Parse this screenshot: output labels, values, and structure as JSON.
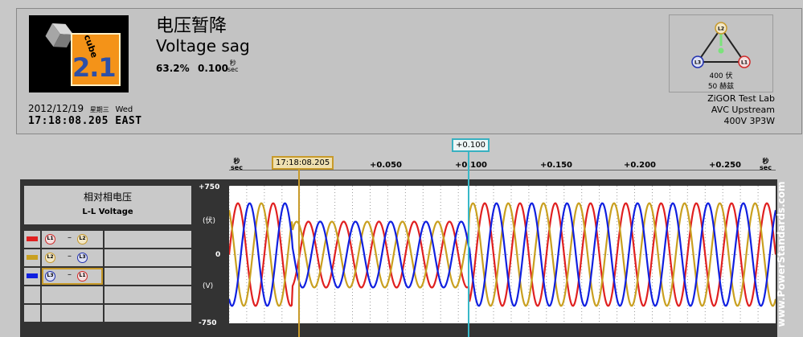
{
  "logo": {
    "word": "cube",
    "version": "2.1"
  },
  "event": {
    "date": "2012/12/19",
    "day_cn": "星期三",
    "day_en": "Wed",
    "time": "17:18:08.205",
    "tz": "EAST",
    "title_cn": "电压暂降",
    "title_en": "Voltage sag",
    "depth": "63.2%",
    "duration": "0.100",
    "duration_unit_cn": "秒",
    "duration_unit_en": "sec"
  },
  "phasor": {
    "labels": [
      "L1",
      "L2",
      "L3"
    ],
    "nominal_cn": "400 伏",
    "freq_cn": "50 赫兹"
  },
  "site": {
    "lab": "ZiGOR Test Lab",
    "location": "AVC Upstream",
    "config": "400V 3P3W"
  },
  "timeline": {
    "sec_cn": "秒",
    "sec_en": "sec",
    "ticks": [
      "+0.050",
      "+0.100",
      "+0.150",
      "+0.200",
      "+0.250"
    ],
    "trigger_label": "17:18:08.205",
    "cursor_label": "+0.100"
  },
  "legend": {
    "title_cn": "相对相电压",
    "title_en": "L-L Voltage",
    "rows": [
      {
        "a": "L1",
        "b": "L2",
        "color": "#e02020",
        "selected": false
      },
      {
        "a": "L2",
        "b": "L3",
        "color": "#c9a020",
        "selected": false
      },
      {
        "a": "L3",
        "b": "L1",
        "color": "#1020e0",
        "selected": true
      }
    ],
    "dash": "–"
  },
  "yaxis": {
    "top": "+750",
    "mid": "0",
    "bottom": "-750",
    "unit_top": "(伏)",
    "unit_bottom": "(V)"
  },
  "watermark": "www.PowerStandards.com",
  "chart_data": {
    "type": "line",
    "xlabel": "sec",
    "ylabel": "V",
    "xlim": [
      -0.04,
      0.27
    ],
    "ylim": [
      -750,
      750
    ],
    "frequency_hz": 50,
    "sag": {
      "start": -0.004,
      "end": 0.096
    },
    "series": [
      {
        "name": "L1-L2",
        "color": "#e02020",
        "phase_deg": 0,
        "amplitude_pre": 560,
        "amplitude_sag": 360,
        "amplitude_post": 560
      },
      {
        "name": "L2-L3",
        "color": "#c9a020",
        "phase_deg": 120,
        "amplitude_pre": 560,
        "amplitude_sag": 360,
        "amplitude_post": 560
      },
      {
        "name": "L3-L1",
        "color": "#1020e0",
        "phase_deg": 240,
        "amplitude_pre": 560,
        "amplitude_sag": 360,
        "amplitude_post": 560
      }
    ],
    "grid": true
  }
}
